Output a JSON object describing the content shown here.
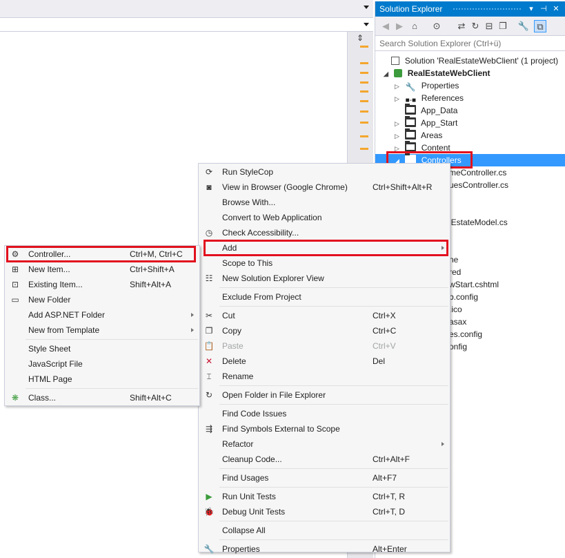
{
  "solution_explorer": {
    "title": "Solution Explorer",
    "title_buttons": [
      "▾",
      "⊣",
      "✕"
    ],
    "search_placeholder": "Search Solution Explorer (Ctrl+ü)",
    "tree": [
      {
        "label": "Solution 'RealEstateWebClient' (1 project)",
        "icon": "solution-icon",
        "expander": ""
      },
      {
        "label": "RealEstateWebClient",
        "icon": "web-project-icon",
        "expander": "◢",
        "bold": true
      },
      {
        "label": "Properties",
        "icon": "wrench-icon",
        "expander": "▷"
      },
      {
        "label": "References",
        "icon": "references-icon",
        "expander": "▷"
      },
      {
        "label": "App_Data",
        "icon": "folder-icon",
        "expander": ""
      },
      {
        "label": "App_Start",
        "icon": "folder-icon",
        "expander": "▷"
      },
      {
        "label": "Areas",
        "icon": "folder-icon",
        "expander": "▷"
      },
      {
        "label": "Content",
        "icon": "folder-icon",
        "expander": "▷"
      },
      {
        "label": "Controllers",
        "icon": "folder-icon",
        "expander": "◢",
        "selected": true
      }
    ],
    "partial_items": [
      "meController.cs",
      "uesController.cs",
      "lEstateModel.cs",
      "ne",
      "red",
      "wStart.cshtml",
      "b.config",
      ".ico",
      "asax",
      "es.config",
      "onfig"
    ]
  },
  "context_menu": {
    "items": [
      {
        "type": "item",
        "label": "Run StyleCop",
        "shortcut": "",
        "icon": "stylecop-icon"
      },
      {
        "type": "item",
        "label": "View in Browser (Google Chrome)",
        "shortcut": "Ctrl+Shift+Alt+R",
        "icon": "browser-icon"
      },
      {
        "type": "item",
        "label": "Browse With...",
        "shortcut": "",
        "icon": ""
      },
      {
        "type": "item",
        "label": "Convert to Web Application",
        "shortcut": "",
        "icon": ""
      },
      {
        "type": "item",
        "label": "Check Accessibility...",
        "shortcut": "",
        "icon": "accessibility-icon"
      },
      {
        "type": "item",
        "label": "Add",
        "shortcut": "",
        "icon": "",
        "submenu": true,
        "highlighted": true
      },
      {
        "type": "item",
        "label": "Scope to This",
        "shortcut": "",
        "icon": ""
      },
      {
        "type": "item",
        "label": "New Solution Explorer View",
        "shortcut": "",
        "icon": "new-view-icon"
      },
      {
        "type": "sep"
      },
      {
        "type": "item",
        "label": "Exclude From Project",
        "shortcut": "",
        "icon": ""
      },
      {
        "type": "sep"
      },
      {
        "type": "item",
        "label": "Cut",
        "shortcut": "Ctrl+X",
        "icon": "cut-icon"
      },
      {
        "type": "item",
        "label": "Copy",
        "shortcut": "Ctrl+C",
        "icon": "copy-icon"
      },
      {
        "type": "item",
        "label": "Paste",
        "shortcut": "Ctrl+V",
        "icon": "paste-icon",
        "disabled": true
      },
      {
        "type": "item",
        "label": "Delete",
        "shortcut": "Del",
        "icon": "delete-icon"
      },
      {
        "type": "item",
        "label": "Rename",
        "shortcut": "",
        "icon": "rename-icon"
      },
      {
        "type": "sep"
      },
      {
        "type": "item",
        "label": "Open Folder in File Explorer",
        "shortcut": "",
        "icon": "refresh-icon"
      },
      {
        "type": "sep"
      },
      {
        "type": "item",
        "label": "Find Code Issues",
        "shortcut": "",
        "icon": ""
      },
      {
        "type": "item",
        "label": "Find Symbols External to Scope",
        "shortcut": "",
        "icon": "symbols-icon"
      },
      {
        "type": "item",
        "label": "Refactor",
        "shortcut": "",
        "icon": "",
        "submenu": true
      },
      {
        "type": "item",
        "label": "Cleanup Code...",
        "shortcut": "Ctrl+Alt+F",
        "icon": ""
      },
      {
        "type": "sep"
      },
      {
        "type": "item",
        "label": "Find Usages",
        "shortcut": "Alt+F7",
        "icon": ""
      },
      {
        "type": "sep"
      },
      {
        "type": "item",
        "label": "Run Unit Tests",
        "shortcut": "Ctrl+T, R",
        "icon": "run-icon"
      },
      {
        "type": "item",
        "label": "Debug Unit Tests",
        "shortcut": "Ctrl+T, D",
        "icon": "bug-icon"
      },
      {
        "type": "sep"
      },
      {
        "type": "item",
        "label": "Collapse All",
        "shortcut": "",
        "icon": ""
      },
      {
        "type": "sep"
      },
      {
        "type": "item",
        "label": "Properties",
        "shortcut": "Alt+Enter",
        "icon": "wrench-icon"
      }
    ]
  },
  "add_submenu": {
    "items": [
      {
        "type": "item",
        "label": "Controller...",
        "shortcut": "Ctrl+M, Ctrl+C",
        "icon": "controller-icon",
        "highlighted": true
      },
      {
        "type": "item",
        "label": "New Item...",
        "shortcut": "Ctrl+Shift+A",
        "icon": "new-item-icon"
      },
      {
        "type": "item",
        "label": "Existing Item...",
        "shortcut": "Shift+Alt+A",
        "icon": "existing-item-icon"
      },
      {
        "type": "item",
        "label": "New Folder",
        "shortcut": "",
        "icon": "new-folder-icon"
      },
      {
        "type": "item",
        "label": "Add ASP.NET Folder",
        "shortcut": "",
        "icon": "",
        "submenu": true
      },
      {
        "type": "item",
        "label": "New from Template",
        "shortcut": "",
        "icon": "",
        "submenu": true
      },
      {
        "type": "sep"
      },
      {
        "type": "item",
        "label": "Style Sheet",
        "shortcut": "",
        "icon": ""
      },
      {
        "type": "item",
        "label": "JavaScript File",
        "shortcut": "",
        "icon": ""
      },
      {
        "type": "item",
        "label": "HTML Page",
        "shortcut": "",
        "icon": ""
      },
      {
        "type": "sep"
      },
      {
        "type": "item",
        "label": "Class...",
        "shortcut": "Shift+Alt+C",
        "icon": "class-icon"
      }
    ]
  },
  "colors": {
    "accent": "#007acc",
    "highlight_border": "#e2101e",
    "selection": "#3399ff",
    "marker": "#f4a52c"
  }
}
